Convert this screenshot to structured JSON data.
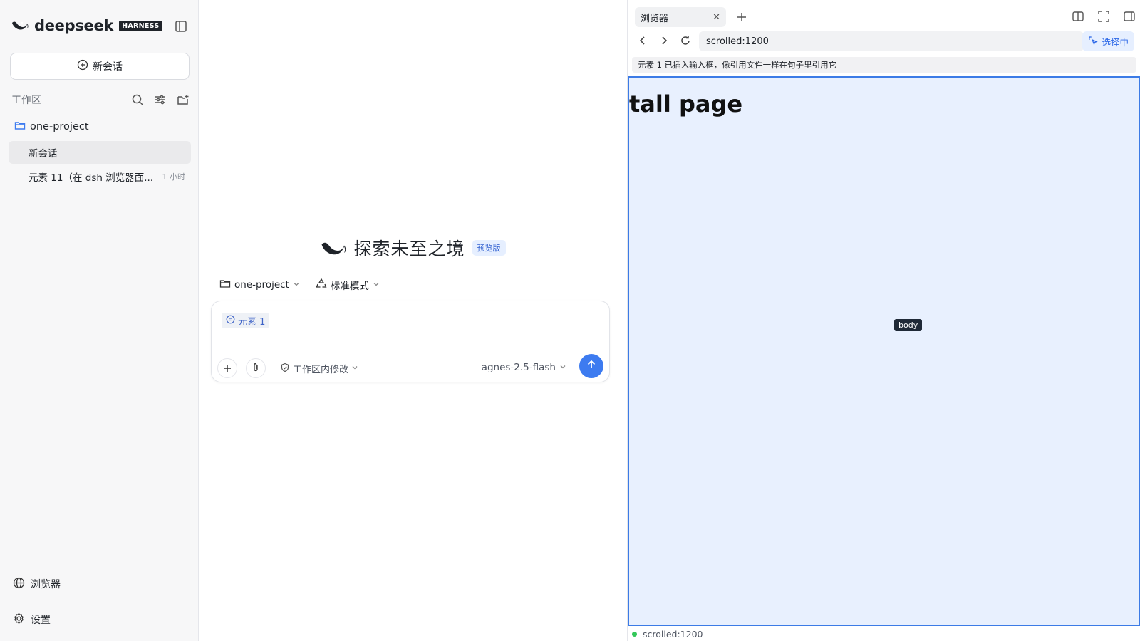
{
  "sidebar": {
    "brand": "deepseek",
    "brand_badge": "HARNESS",
    "new_chat_label": "新会话",
    "workspace_label": "工作区",
    "project_name": "one-project",
    "sessions": [
      {
        "title": "新会话",
        "time": ""
      },
      {
        "title": "元素 11（在 dsh 浏览器面...",
        "time": "1 小时"
      }
    ],
    "browser_label": "浏览器",
    "settings_label": "设置"
  },
  "center": {
    "hero_title": "探索未至之境",
    "hero_badge": "预览版",
    "project_selector": "one-project",
    "mode_selector": "标准模式",
    "chip_label": "元素 1",
    "permission_label": "工作区内修改",
    "model_label": "agnes-2.5-flash"
  },
  "browser": {
    "tab_title": "浏览器",
    "url": "scrolled:1200",
    "select_label": "选择中",
    "notice": "元素 1 已插入输入框，像引用文件一样在句子里引用它",
    "page_heading": "tall page",
    "hover_tag": "body",
    "status_text": "scrolled:1200"
  },
  "colors": {
    "accent": "#3d7bf0",
    "selection_border": "#3c7be6",
    "selection_fill": "#e8f0fe",
    "status_dot": "#34c759"
  }
}
